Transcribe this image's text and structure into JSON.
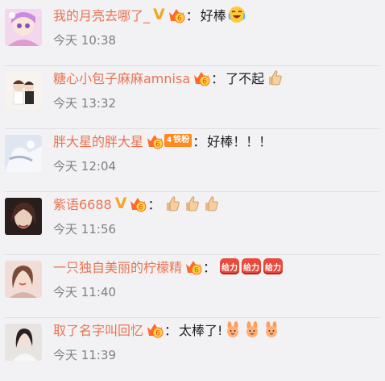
{
  "comments": [
    {
      "user": "我的月亮去哪了_",
      "comment": "好棒",
      "time_label": "今天",
      "time": "10:38"
    },
    {
      "user": "糖心小包子麻麻amnisa",
      "comment": "了不起",
      "time_label": "今天",
      "time": "13:32"
    },
    {
      "user": "胖大星的胖大星",
      "fan_level": "4",
      "fan_label": "铁粉",
      "comment": "好棒！！！",
      "time_label": "今天",
      "time": "12:04"
    },
    {
      "user": "紫语6688",
      "comment": "",
      "time_label": "今天",
      "time": "11:56"
    },
    {
      "user": "一只独自美丽的柠檬精",
      "emoji_text": "给力",
      "comment": "",
      "time_label": "今天",
      "time": "11:40"
    },
    {
      "user": "取了名字叫回忆",
      "comment": "太棒了!",
      "time_label": "今天",
      "time": "11:39"
    }
  ],
  "colon": "：",
  "verified_mark": "V",
  "crown_badge_digit": "6",
  "icons": {
    "crown": "crown-badge-icon",
    "verified": "verified-v-icon",
    "laugh": "laugh-cry-emoji-icon",
    "thumb": "thumbs-up-icon",
    "geili": "geili-emoji-icon",
    "rabbit": "rabbit-emoji-icon"
  },
  "colors": {
    "username": "#eb7350",
    "time": "#808080",
    "background": "#f2f2f5"
  }
}
